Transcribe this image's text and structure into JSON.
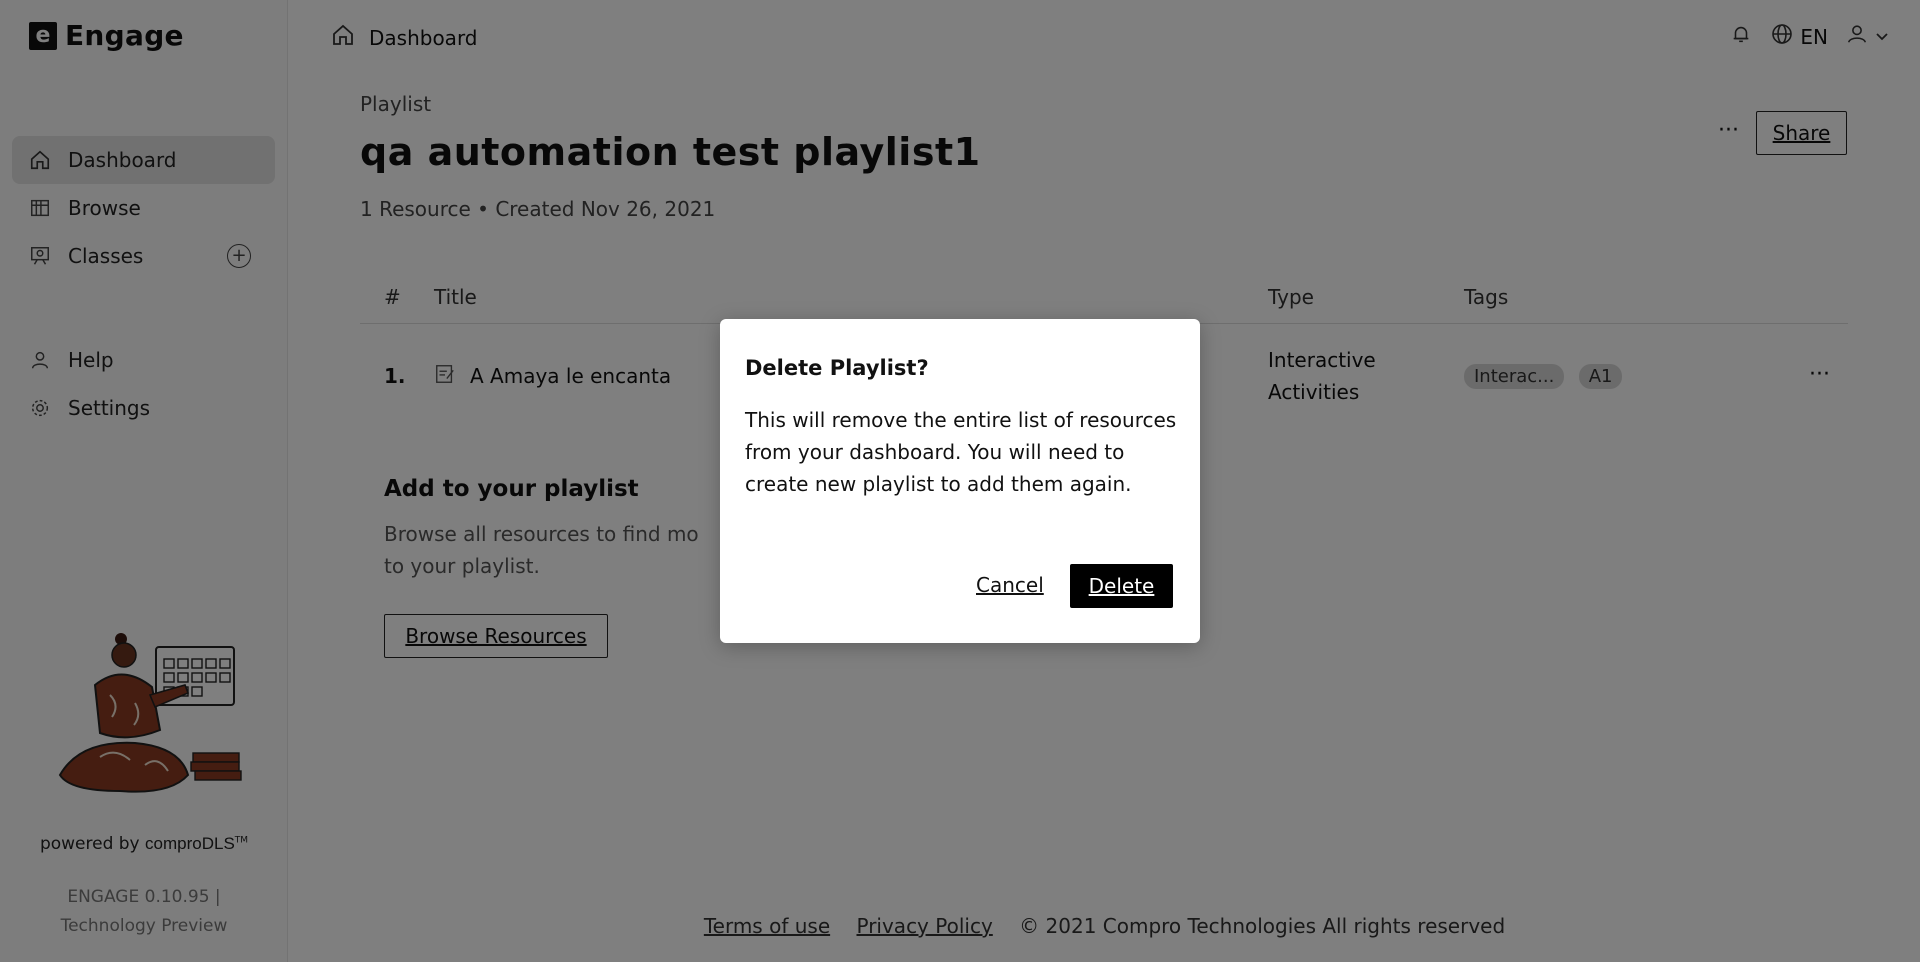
{
  "app": {
    "logo_letter": "e",
    "name": "Engage"
  },
  "sidebar": {
    "items": [
      {
        "label": "Dashboard",
        "icon": "home-icon",
        "active": true
      },
      {
        "label": "Browse",
        "icon": "browse-icon"
      },
      {
        "label": "Classes",
        "icon": "classes-icon"
      }
    ],
    "secondary": [
      {
        "label": "Help",
        "icon": "help-icon"
      },
      {
        "label": "Settings",
        "icon": "gear-icon"
      }
    ],
    "powered_prefix": "powered by ",
    "powered_brand": "comproDLS",
    "powered_tm": "TM",
    "version_line1": "ENGAGE 0.10.95 |",
    "version_line2": "Technology Preview"
  },
  "topbar": {
    "breadcrumb": "Dashboard",
    "language": "EN"
  },
  "playlist": {
    "eyebrow": "Playlist",
    "title": "qa automation test playlist1",
    "meta": "1 Resource •  Created Nov 26, 2021",
    "share_label": "Share",
    "more_label": "···"
  },
  "table": {
    "headers": {
      "num": "#",
      "title": "Title",
      "type": "Type",
      "tags": "Tags"
    },
    "rows": [
      {
        "num": "1.",
        "title": "A Amaya le encanta",
        "type_line1": "Interactive",
        "type_line2": "Activities",
        "tags": [
          "Interac...",
          "A1"
        ]
      }
    ]
  },
  "add_section": {
    "title": "Add to your playlist",
    "desc_line1": "Browse all resources to find mo",
    "desc_line2": "to your playlist.",
    "button": "Browse Resources"
  },
  "footer": {
    "terms": "Terms of use",
    "privacy": "Privacy Policy",
    "copyright": "© 2021 Compro Technologies All rights reserved"
  },
  "modal": {
    "title": "Delete Playlist?",
    "body": "This will remove the entire list of resources from your dashboard. You will need to create new playlist to add them again.",
    "cancel": "Cancel",
    "delete": "Delete"
  }
}
